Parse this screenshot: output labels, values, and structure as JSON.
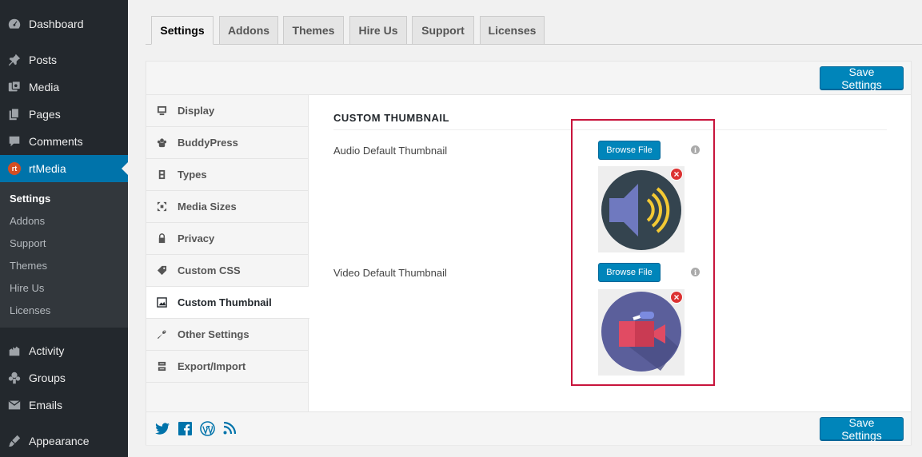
{
  "admin_menu": {
    "items": [
      {
        "label": "Dashboard",
        "icon": "dashboard-icon"
      },
      {
        "label": "Posts",
        "icon": "pin-icon"
      },
      {
        "label": "Media",
        "icon": "media-icon"
      },
      {
        "label": "Pages",
        "icon": "pages-icon"
      },
      {
        "label": "Comments",
        "icon": "comment-icon"
      },
      {
        "label": "rtMedia",
        "icon": "rtmedia-logo-icon"
      },
      {
        "label": "Activity",
        "icon": "activity-icon"
      },
      {
        "label": "Groups",
        "icon": "groups-icon"
      },
      {
        "label": "Emails",
        "icon": "email-icon"
      },
      {
        "label": "Appearance",
        "icon": "brush-icon"
      }
    ],
    "rt_badge": "rt",
    "submenu": [
      "Settings",
      "Addons",
      "Support",
      "Themes",
      "Hire Us",
      "Licenses"
    ]
  },
  "tabs": [
    "Settings",
    "Addons",
    "Themes",
    "Hire Us",
    "Support",
    "Licenses"
  ],
  "save_label": "Save Settings",
  "side_nav": [
    {
      "label": "Display",
      "icon": "monitor-icon"
    },
    {
      "label": "BuddyPress",
      "icon": "buddypress-icon"
    },
    {
      "label": "Types",
      "icon": "film-strip-icon"
    },
    {
      "label": "Media Sizes",
      "icon": "resize-icon"
    },
    {
      "label": "Privacy",
      "icon": "lock-icon"
    },
    {
      "label": "Custom CSS",
      "icon": "tag-icon"
    },
    {
      "label": "Custom Thumbnail",
      "icon": "image-icon"
    },
    {
      "label": "Other Settings",
      "icon": "wrench-icon"
    },
    {
      "label": "Export/Import",
      "icon": "export-icon"
    }
  ],
  "content": {
    "section_title": "CUSTOM THUMBNAIL",
    "audio": {
      "label": "Audio Default Thumbnail",
      "button": "Browse File",
      "thumb_icon": "speaker-icon"
    },
    "video": {
      "label": "Video Default Thumbnail",
      "button": "Browse File",
      "thumb_icon": "video-camera-icon"
    },
    "info_glyph": "i",
    "remove_glyph": "×"
  },
  "social": [
    "twitter-icon",
    "facebook-icon",
    "wordpress-icon",
    "rss-icon"
  ],
  "colors": {
    "admin_bg": "#23282d",
    "accent": "#0073aa",
    "button": "#0085ba",
    "highlight": "#c8143c",
    "remove": "#dc3232"
  }
}
